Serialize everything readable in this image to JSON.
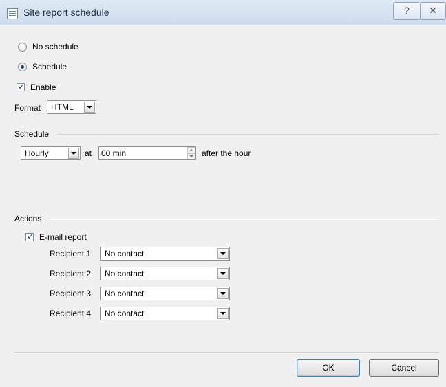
{
  "window": {
    "title": "Site report schedule",
    "help_glyph": "?",
    "close_glyph": "✕"
  },
  "schedule_mode": {
    "options": [
      "No schedule",
      "Schedule"
    ],
    "selected": "Schedule"
  },
  "enable": {
    "label": "Enable",
    "checked": true
  },
  "format": {
    "label": "Format",
    "value": "HTML"
  },
  "schedule_group": {
    "title": "Schedule",
    "frequency": "Hourly",
    "at_label": "at",
    "minutes": "00 min",
    "suffix": "after the hour"
  },
  "actions_group": {
    "title": "Actions",
    "email_report": {
      "label": "E-mail report",
      "checked": true
    },
    "recipients": [
      {
        "label": "Recipient 1",
        "value": "No contact"
      },
      {
        "label": "Recipient 2",
        "value": "No contact"
      },
      {
        "label": "Recipient 3",
        "value": "No contact"
      },
      {
        "label": "Recipient 4",
        "value": "No contact"
      }
    ]
  },
  "buttons": {
    "ok": "OK",
    "cancel": "Cancel"
  }
}
